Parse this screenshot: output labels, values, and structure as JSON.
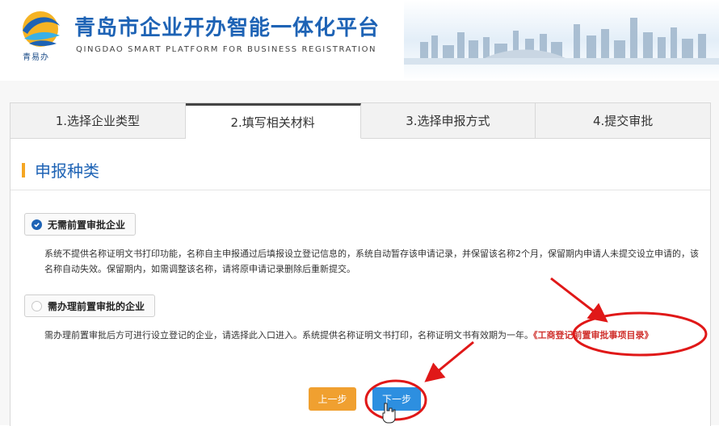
{
  "header": {
    "title": "青岛市企业开办智能一体化平台",
    "subtitle": "QINGDAO SMART PLATFORM FOR BUSINESS REGISTRATION",
    "logo_caption": "青易办"
  },
  "tabs": [
    {
      "label": "1.选择企业类型"
    },
    {
      "label": "2.填写相关材料"
    },
    {
      "label": "3.选择申报方式"
    },
    {
      "label": "4.提交审批"
    }
  ],
  "section": {
    "title": "申报种类"
  },
  "options": [
    {
      "label": "无需前置审批企业",
      "selected": true,
      "description": "系统不提供名称证明文书打印功能，名称自主申报通过后填报设立登记信息的，系统自动暂存该申请记录，并保留该名称2个月，保留期内申请人未提交设立申请的，该名称自动失效。保留期内，如需调整该名称，请将原申请记录删除后重新提交。"
    },
    {
      "label": "需办理前置审批的企业",
      "selected": false,
      "description": "需办理前置审批后方可进行设立登记的企业，请选择此入口进入。系统提供名称证明文书打印，名称证明文书有效期为一年。",
      "link": "《工商登记前置审批事项目录》"
    }
  ],
  "buttons": {
    "prev": "上一步",
    "next": "下一步"
  },
  "colors": {
    "brand_blue": "#1e63b5",
    "accent_orange": "#f0a030",
    "next_blue": "#2d8fe0",
    "annotation_red": "#e01818"
  },
  "icons": [
    "logo-icon",
    "radio-checked-icon",
    "radio-unchecked-icon",
    "hand-cursor-icon",
    "arrow-annotation-icon"
  ]
}
